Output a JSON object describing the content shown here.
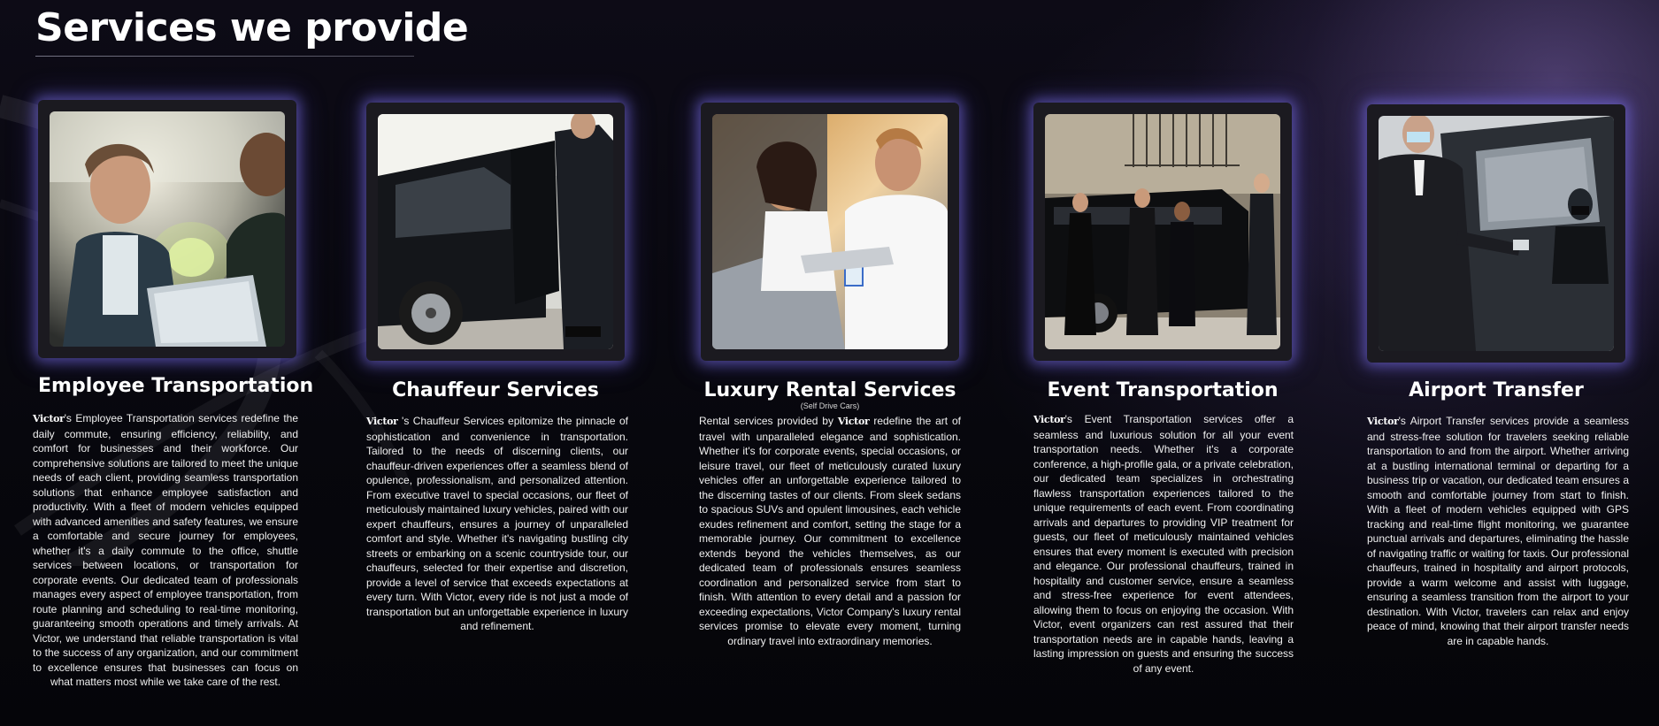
{
  "page": {
    "title": "Services we provide",
    "brand": "Victor"
  },
  "services": [
    {
      "title": "Employee Transportation",
      "subtitle": "",
      "description": "'s Employee Transportation services redefine the daily commute, ensuring efficiency, reliability, and comfort for businesses and their workforce. Our comprehensive solutions are tailored to meet the unique needs of each client, providing seamless transportation solutions that enhance employee satisfaction and productivity. With a fleet of modern vehicles equipped with advanced amenities and safety features, we ensure a comfortable and secure journey for employees, whether it's a daily commute to the office, shuttle services between locations, or transportation for corporate events. Our dedicated team of professionals manages every aspect of employee transportation, from route planning and scheduling to real-time monitoring, guaranteeing smooth operations and timely arrivals. At Victor, we understand that reliable transportation is vital to the success of any organization, and our commitment to excellence ensures that businesses can focus on what matters most while we take care of the rest.",
      "image": "employee-transportation-photo"
    },
    {
      "title": "Chauffeur Services",
      "subtitle": "",
      "description": " 's Chauffeur Services epitomize the pinnacle of sophistication and convenience in transportation. Tailored to the needs of discerning clients, our chauffeur-driven experiences offer a seamless blend of opulence, professionalism, and personalized attention. From executive travel to special occasions, our fleet of meticulously maintained luxury vehicles, paired with our expert chauffeurs, ensures a journey of unparalleled comfort and style. Whether it's navigating bustling city streets or embarking on a scenic countryside tour, our chauffeurs, selected for their expertise and discretion, provide a level of service that exceeds expectations at every turn. With Victor, every ride is not just a mode of transportation but an unforgettable experience in luxury and refinement.",
      "image": "chauffeur-services-photo"
    },
    {
      "title": "Luxury Rental Services",
      "subtitle": "(Self Drive Cars)",
      "description_before": "Rental services provided by ",
      "description": " redefine the art of travel with unparalleled elegance and sophistication. Whether it's for corporate events, special occasions, or leisure travel, our fleet of meticulously curated luxury vehicles offer an unforgettable experience tailored to the discerning tastes of our clients. From sleek sedans to spacious SUVs and opulent limousines, each vehicle exudes refinement and comfort, setting the stage for a memorable journey. Our commitment to excellence extends beyond the vehicles themselves, as our dedicated team of professionals ensures seamless coordination and personalized service from start to finish. With attention to every detail and a passion for exceeding expectations, Victor Company's luxury rental services promise to elevate every moment, turning ordinary travel into extraordinary memories.",
      "image": "luxury-rental-photo"
    },
    {
      "title": "Event Transportation",
      "subtitle": "",
      "description": "'s Event Transportation services offer a seamless and luxurious solution for all your event transportation needs. Whether it's a corporate conference, a high-profile gala, or a private celebration, our dedicated team specializes in orchestrating flawless transportation experiences tailored to the unique requirements of each event. From coordinating arrivals and departures to providing VIP treatment for guests, our fleet of meticulously maintained vehicles ensures that every moment is executed with precision and elegance. Our professional chauffeurs, trained in hospitality and customer service, ensure a seamless and stress-free experience for event attendees, allowing them to focus on enjoying the occasion. With Victor, event organizers can rest assured that their transportation needs are in capable hands, leaving a lasting impression on guests and ensuring the success of any event.",
      "image": "event-transportation-photo"
    },
    {
      "title": "Airport Transfer",
      "subtitle": "",
      "description": "'s Airport Transfer services provide a seamless and stress-free solution for travelers seeking reliable transportation to and from the airport. Whether arriving at a bustling international terminal or departing for a business trip or vacation, our dedicated team ensures a smooth and comfortable journey from start to finish. With a fleet of modern vehicles equipped with GPS tracking and real-time flight monitoring, we guarantee punctual arrivals and departures, eliminating the hassle of navigating traffic or waiting for taxis. Our professional chauffeurs, trained in hospitality and airport protocols, provide a warm welcome and assist with luggage, ensuring a seamless transition from the airport to your destination. With Victor, travelers can relax and enjoy peace of mind, knowing that their airport transfer needs are in capable hands.",
      "image": "airport-transfer-photo"
    }
  ],
  "colors": {
    "background": "#07070c",
    "glow": "#7a6ee6",
    "accent_purple": "#6e5aa6",
    "text": "#ffffff"
  }
}
